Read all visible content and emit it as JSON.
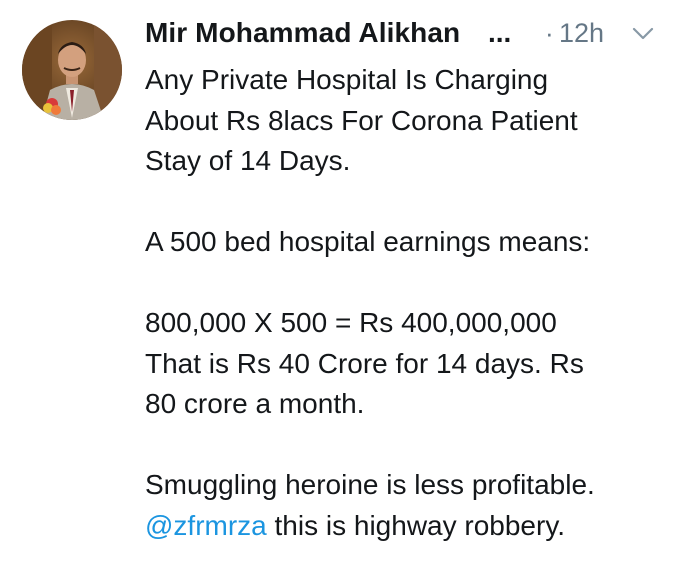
{
  "tweet": {
    "display_name": "Mir Mohammad Alikhan",
    "ellipsis": "...",
    "dot": "·",
    "timestamp": "12h",
    "caret_icon": "chevron-down-icon",
    "avatar_icon": "profile-photo",
    "body": {
      "p1_l1": "Any Private Hospital Is Charging",
      "p1_l2": "About Rs 8lacs For Corona Patient",
      "p1_l3": "Stay of 14 Days.",
      "p2_l1": "A 500 bed hospital earnings means:",
      "p3_l1": "800,000 X 500 = Rs 400,000,000",
      "p3_l2": "That is Rs 40 Crore for 14 days. Rs",
      "p3_l3": "80 crore a month.",
      "p4_l1": "Smuggling heroine is less profitable.",
      "p4_mention": "@zfrmrza",
      "p4_l2_rest": " this is highway robbery."
    },
    "colors": {
      "text": "#14171a",
      "muted": "#657786",
      "link": "#1b95e0"
    }
  }
}
